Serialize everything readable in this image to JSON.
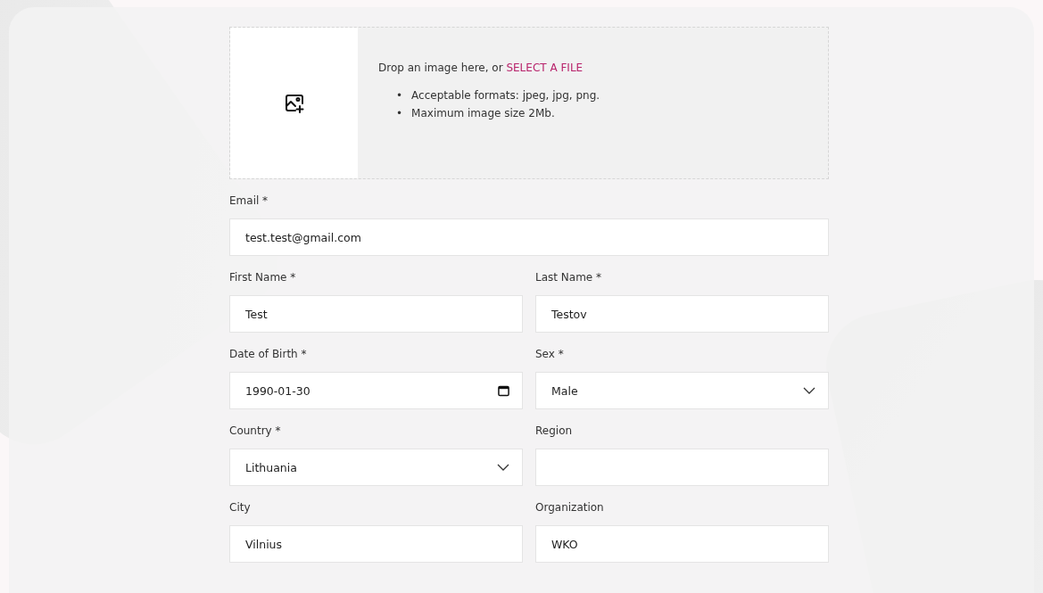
{
  "upload": {
    "prompt": "Drop an image here, or",
    "link": "SELECT A FILE",
    "rules": [
      {
        "bullet": "•",
        "text": "Acceptable formats: jpeg, jpg, png."
      },
      {
        "bullet": "•",
        "text": "Maximum image size 2Mb."
      }
    ]
  },
  "rows": [
    [
      {
        "label": "Email *",
        "kind": "text",
        "value": "test.test@gmail.com"
      }
    ],
    [
      {
        "label": "First Name *",
        "kind": "text",
        "value": "Test"
      },
      {
        "label": "Last Name *",
        "kind": "text",
        "value": "Testov"
      }
    ],
    [
      {
        "label": "Date of Birth *",
        "kind": "date",
        "value": "1990-01-30"
      },
      {
        "label": "Sex *",
        "kind": "select",
        "value": "Male"
      }
    ],
    [
      {
        "label": "Country *",
        "kind": "select",
        "value": "Lithuania"
      },
      {
        "label": "Region",
        "kind": "text"
      }
    ],
    [
      {
        "label": "City",
        "kind": "text",
        "value": "Vilnius"
      },
      {
        "label": "Organization",
        "kind": "text",
        "value": "WKO"
      }
    ]
  ]
}
